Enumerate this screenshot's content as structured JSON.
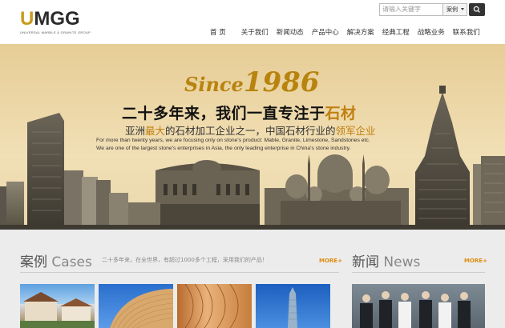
{
  "header": {
    "logo_letters": [
      "U",
      "M",
      "G",
      "G"
    ],
    "logo_tagline": "UNIVERSAL MARBLE & GRANITE GROUP",
    "search_placeholder": "请输入关键字",
    "search_scope": "案例",
    "nav": [
      "首 页",
      "关于我们",
      "新闻动态",
      "产品中心",
      "解决方案",
      "经典工程",
      "战略业务",
      "联系我们"
    ]
  },
  "banner": {
    "since_word": "Since",
    "since_year": "1986",
    "title_prefix": "二十多年来，我们一直专注于",
    "title_highlight": "石材",
    "subtitle_a": "亚洲",
    "subtitle_b": "最大",
    "subtitle_c": "的石材加工企业之一，中国石材行业的",
    "subtitle_d": "领军企业",
    "en_line1": "For more than twenty years, we are focusing only on stone's product: Mable, Granite, Limestone, Sandstones etc.",
    "en_line2": "We are one of the largest stone's enterprises in Asia, the only leading enterprise in China's stone industry."
  },
  "cases": {
    "title_cn": "案例",
    "title_en": "Cases",
    "description": "二十多年来，在全世界，有超过1000多个工程，采用我们的产品！",
    "more": "MORE+"
  },
  "news": {
    "title_cn": "新闻",
    "title_en": "News",
    "more": "MORE+"
  },
  "colors": {
    "gold": "#c08010",
    "more": "#e08b12"
  }
}
